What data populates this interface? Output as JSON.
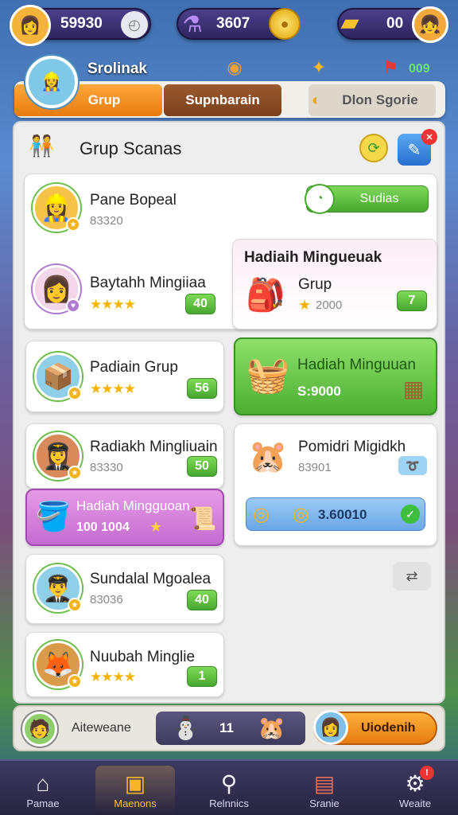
{
  "currency": {
    "left_value": "59930",
    "middle_value": "3607",
    "right_value": "00"
  },
  "profile": {
    "name": "Srolinak",
    "side_value": "009"
  },
  "tabs": [
    {
      "label": "Grup"
    },
    {
      "label": "Supnbarain"
    },
    {
      "label": "Dlon Sgorie"
    }
  ],
  "panel": {
    "title": "Grup Scanas"
  },
  "cards": {
    "c1": {
      "name": "Pane Bopeal",
      "sub": "83320",
      "button": "Sudias"
    },
    "c2": {
      "name": "Baytahh Mingiiaa",
      "stars": "★★★★",
      "score": "40"
    },
    "c3": {
      "title": "Hadiaih Mingueuak",
      "name": "Grup",
      "value": "2000",
      "score": "7"
    },
    "c4": {
      "name": "Padiain Grup",
      "stars": "★★★★",
      "score": "56"
    },
    "c5": {
      "title": "Hadiah Minguuan",
      "value": "S:9000"
    },
    "c6": {
      "name": "Radiakh Mingliuain",
      "sub": "83330",
      "score": "50"
    },
    "c7": {
      "title": "Hadiah Mingguoan",
      "value": "100 1004"
    },
    "c8": {
      "name": "Pomidri Migidkh",
      "sub": "83901"
    },
    "c9": {
      "value": "3.60010"
    },
    "c10": {
      "name": "Sundalal Mgoalea",
      "sub": "83036",
      "score": "40"
    },
    "c11": {
      "name": "Nuubah Minglie",
      "stars": "★★★★",
      "score": "1"
    }
  },
  "bottom": {
    "left_label": "Aiteweane",
    "middle_value": "11",
    "right_label": "Uiodenih"
  },
  "nav": [
    {
      "label": "Pamae",
      "icon": "home-icon",
      "glyph": "⌂"
    },
    {
      "label": "Maenons",
      "icon": "badge-icon",
      "glyph": "▣"
    },
    {
      "label": "Relnnics",
      "icon": "search-icon",
      "glyph": "⚲"
    },
    {
      "label": "Sranie",
      "icon": "shop-icon",
      "glyph": "▤"
    },
    {
      "label": "Weaite",
      "icon": "settings-icon",
      "glyph": "⚙"
    }
  ],
  "colors": {
    "green": "#47a82e",
    "orange": "#f08a1a",
    "purple": "#c46bd0",
    "blue": "#6aa6e8"
  }
}
